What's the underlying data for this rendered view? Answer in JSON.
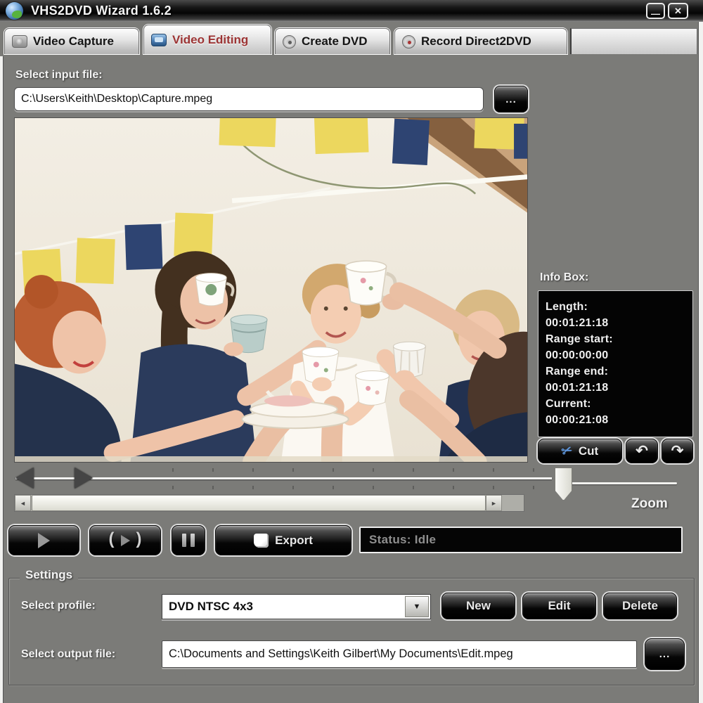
{
  "window": {
    "title": "VHS2DVD Wizard 1.6.2"
  },
  "tabs": [
    {
      "label": "Video Capture",
      "active": false
    },
    {
      "label": "Video Editing",
      "active": true
    },
    {
      "label": "Create DVD",
      "active": false
    },
    {
      "label": "Record Direct2DVD",
      "active": false
    }
  ],
  "input_file": {
    "label": "Select input file:",
    "value": "C:\\Users\\Keith\\Desktop\\Capture.mpeg"
  },
  "info_box": {
    "title": "Info Box:",
    "fields": [
      {
        "label": "Length:",
        "value": "00:01:21:18"
      },
      {
        "label": "Range start:",
        "value": "00:00:00:00"
      },
      {
        "label": "Range end:",
        "value": "00:01:21:18"
      },
      {
        "label": "Current:",
        "value": "00:00:21:08"
      }
    ]
  },
  "edit_tools": {
    "cut_label": "Cut"
  },
  "zoom_control": {
    "label": "Zoom"
  },
  "transport": {
    "export_label": "Export"
  },
  "status_bar": {
    "text": "Status: Idle"
  },
  "settings": {
    "legend": "Settings",
    "profile_label": "Select profile:",
    "profile_value": "DVD NTSC 4x3",
    "buttons": {
      "new": "New",
      "edit": "Edit",
      "delete": "Delete"
    },
    "output_label": "Select output file:",
    "output_value": "C:\\Documents and Settings\\Keith Gilbert\\My Documents\\Edit.mpeg"
  },
  "icons": {
    "app": "globe",
    "minimize": "—",
    "close": "✕",
    "browse": "...",
    "scissors": "✂",
    "undo": "↶",
    "redo": "↷",
    "paren_left": "(",
    "paren_right": ")",
    "dropdown": "▼",
    "scroll_left": "◄",
    "scroll_right": "►"
  },
  "colors": {
    "window_bg": "#7b7b78",
    "active_tab_text": "#9c3434",
    "panel_black": "#050505",
    "flag_yellow": "#ecd75e",
    "flag_navy": "#2e4472"
  }
}
